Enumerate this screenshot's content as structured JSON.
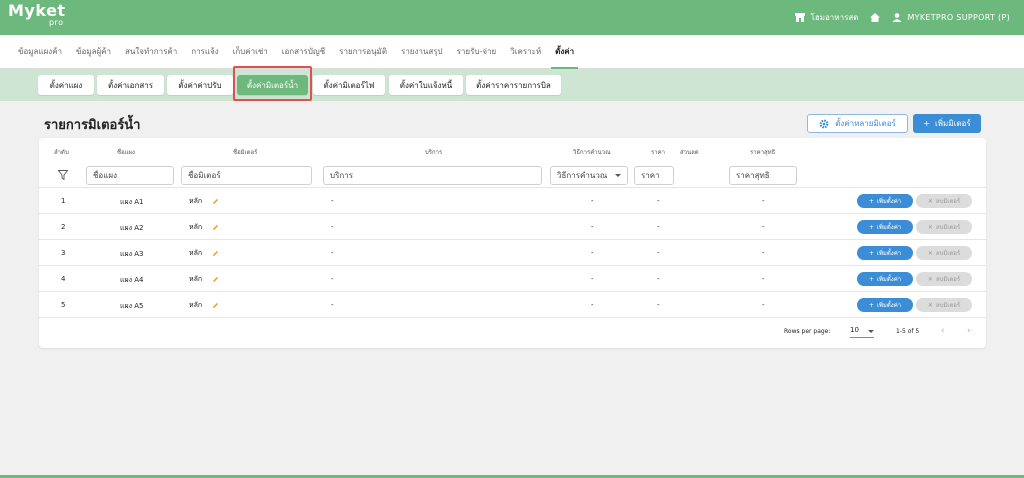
{
  "app": {
    "logo": "Myket",
    "logo_sub": "pro"
  },
  "topbar": {
    "shop_name": "โฮมอาหารสด",
    "user_name": "MYKETPRO SUPPORT (P)"
  },
  "mainnav": [
    "ข้อมูลแผงค้า",
    "ข้อมูลผู้ค้า",
    "สนใจทำการค้า",
    "การแจ้ง",
    "เก็บค่าเช่า",
    "เอกสารบัญชี",
    "รายการอนุมัติ",
    "รายงานสรุป",
    "รายรับ-จ่าย",
    "วิเคราะห์",
    "ตั้งค่า"
  ],
  "subtabs": [
    "ตั้งค่าแผง",
    "ตั้งค่าเอกสาร",
    "ตั้งค่าค่าปรับ",
    "ตั้งค่ามิเตอร์น้ำ",
    "ตั้งค่ามิเตอร์ไฟ",
    "ตั้งค่าใบแจ้งหนี้",
    "ตั้งค่าราคารายการบิล"
  ],
  "page": {
    "title": "รายการมิเตอร์น้ำ",
    "multi_meter_button": "ตั้งค่าหลายมิเตอร์",
    "add_meter_button": "เพิ่มมิเตอร์"
  },
  "table": {
    "headers": [
      "ลำดับ",
      "ชื่อแผง",
      "ชื่อมิเตอร์",
      "บริการ",
      "วิธีการคำนวณ",
      "ราคา",
      "ส่วนลด",
      "ราคาสุทธิ"
    ],
    "filters": {
      "stall": "ชื่อแผง",
      "meter": "ชื่อมิเตอร์",
      "service": "บริการ",
      "calc": "วิธีการคำนวณ",
      "price": "ราคา",
      "net": "ราคาสุทธิ"
    },
    "rows": [
      {
        "no": "1",
        "stall": "แผง A1",
        "meter": "หลัก",
        "service": "-",
        "calc": "-",
        "price": "-",
        "net": "-"
      },
      {
        "no": "2",
        "stall": "แผง A2",
        "meter": "หลัก",
        "service": "-",
        "calc": "-",
        "price": "-",
        "net": "-"
      },
      {
        "no": "3",
        "stall": "แผง A3",
        "meter": "หลัก",
        "service": "-",
        "calc": "-",
        "price": "-",
        "net": "-"
      },
      {
        "no": "4",
        "stall": "แผง A4",
        "meter": "หลัก",
        "service": "-",
        "calc": "-",
        "price": "-",
        "net": "-"
      },
      {
        "no": "5",
        "stall": "แผง A5",
        "meter": "หลัก",
        "service": "-",
        "calc": "-",
        "price": "-",
        "net": "-"
      }
    ],
    "row_add_label": "เพิ่มตั้งค่า",
    "row_del_label": "ลบมิเตอร์"
  },
  "pager": {
    "rows_per_page_label": "Rows per page:",
    "rows_per_page": "10",
    "range": "1-5 of 5"
  },
  "colors": {
    "brand": "#6db97d",
    "subbar": "#cfe5d3",
    "primary": "#3b8ed6",
    "highlight": "#d9534f"
  }
}
